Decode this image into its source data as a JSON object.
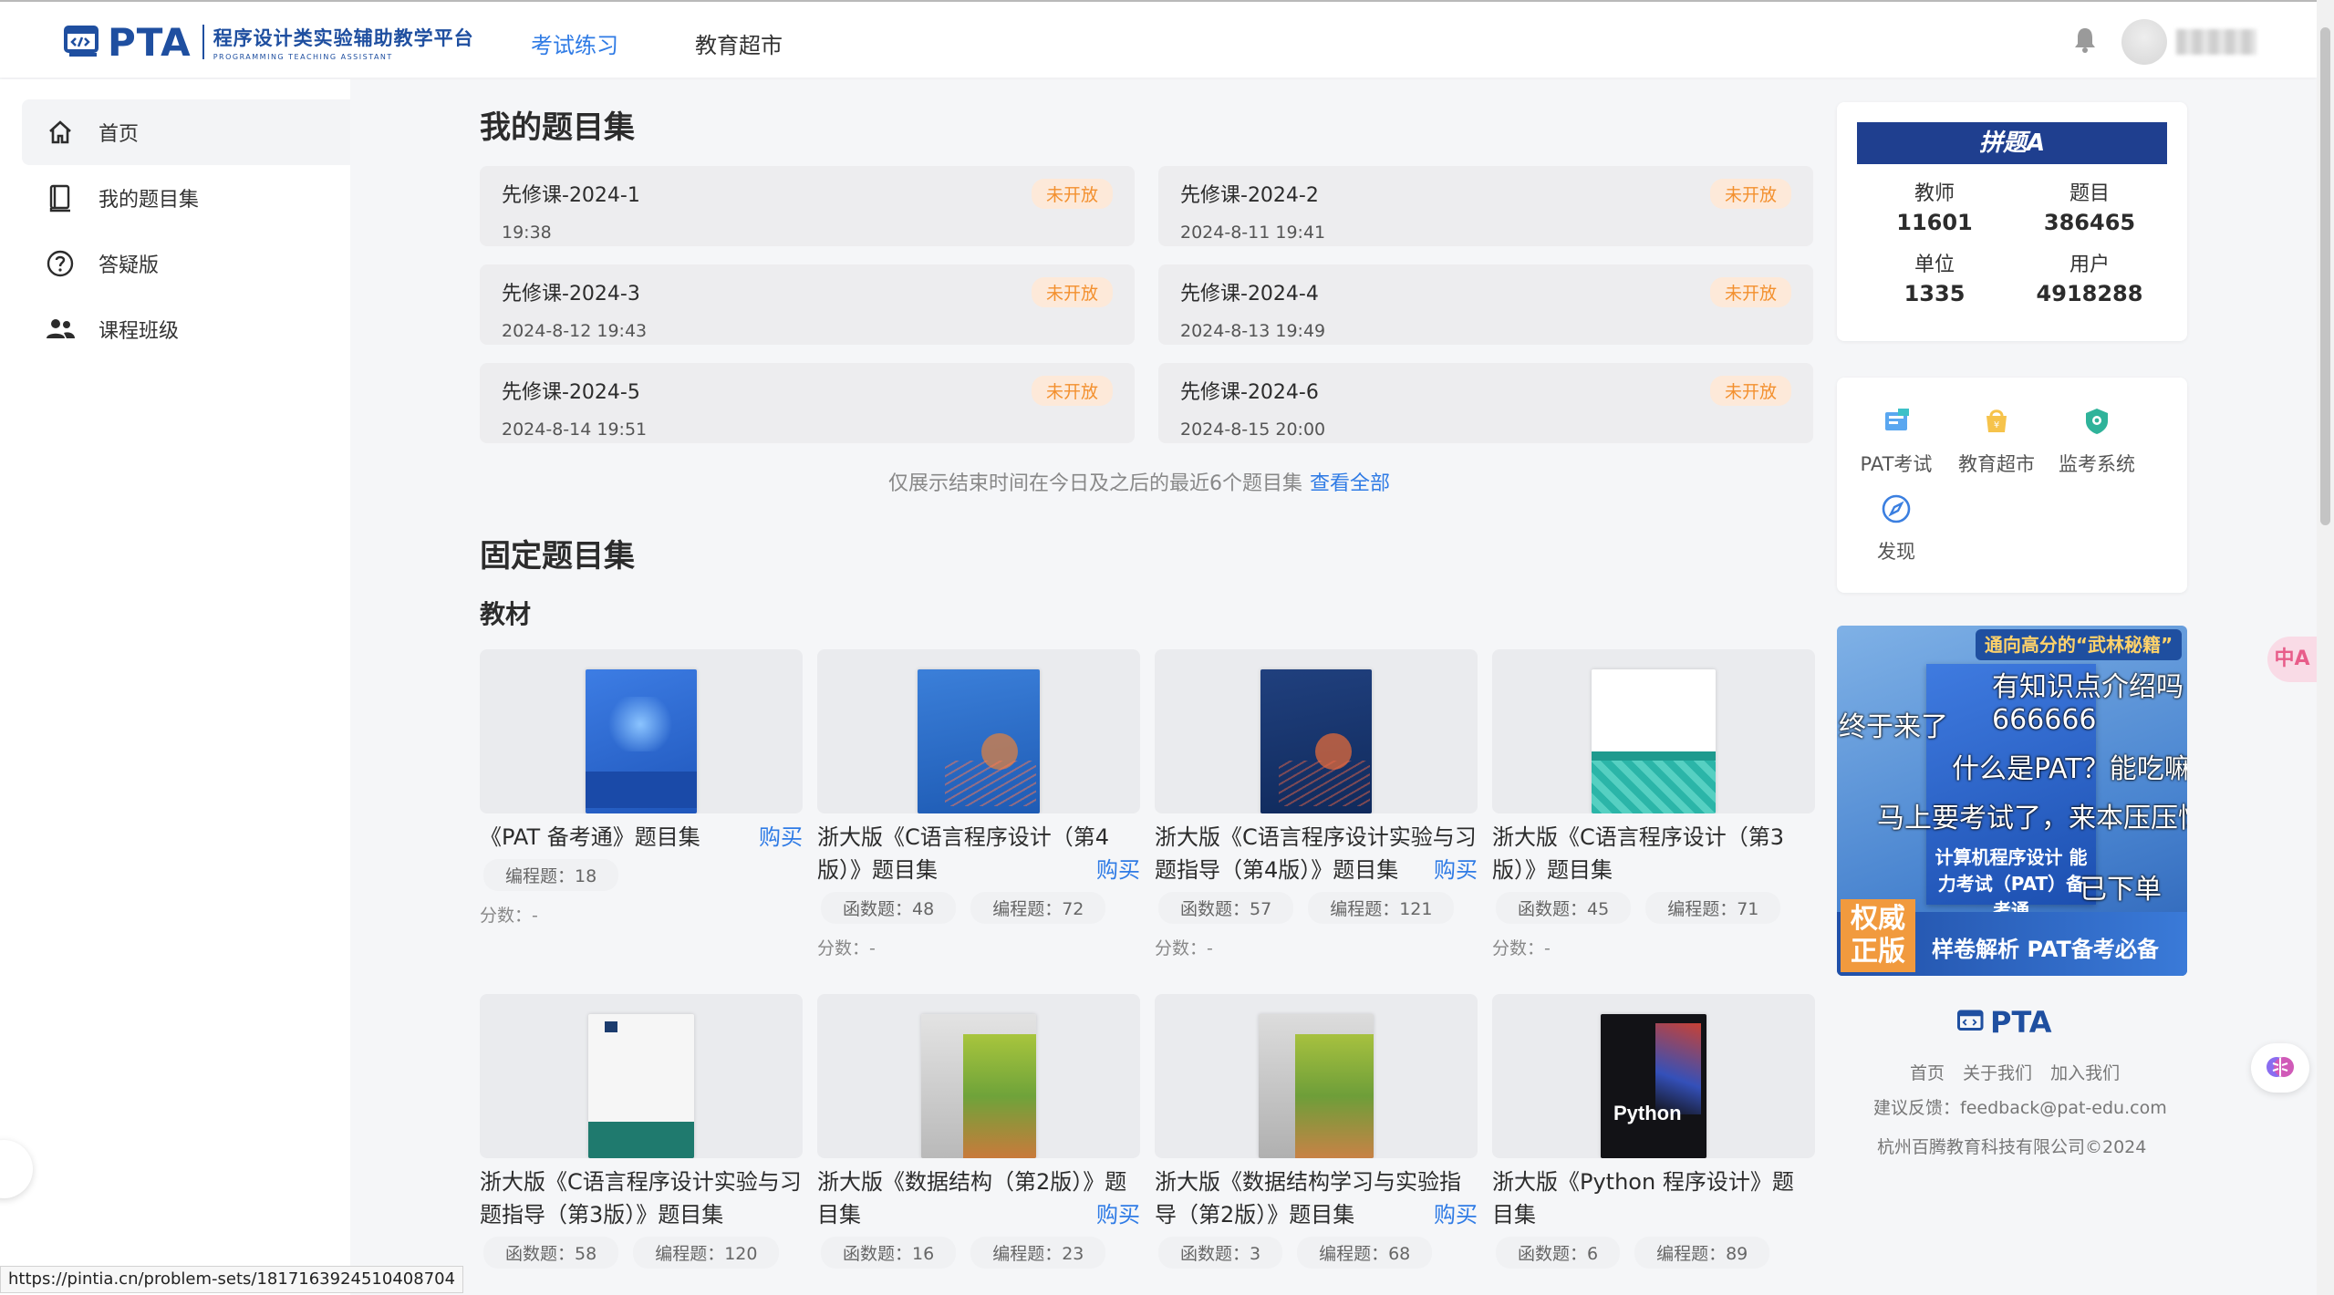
{
  "header": {
    "logo_pta": "PTA",
    "logo_cn": "程序设计类实验辅助教学平台",
    "logo_en": "PROGRAMMING TEACHING ASSISTANT",
    "nav": [
      "考试练习",
      "教育超市"
    ]
  },
  "sidebar": {
    "items": [
      {
        "label": "首页",
        "icon": "home-icon"
      },
      {
        "label": "我的题目集",
        "icon": "book-icon"
      },
      {
        "label": "答疑版",
        "icon": "question-icon"
      },
      {
        "label": "课程班级",
        "icon": "people-icon"
      }
    ]
  },
  "my_sets": {
    "title": "我的题目集",
    "items": [
      {
        "name": "先修课-2024-1",
        "time": "19:38",
        "status": "未开放"
      },
      {
        "name": "先修课-2024-2",
        "time": "2024-8-11 19:41",
        "status": "未开放"
      },
      {
        "name": "先修课-2024-3",
        "time": "2024-8-12 19:43",
        "status": "未开放"
      },
      {
        "name": "先修课-2024-4",
        "time": "2024-8-13 19:49",
        "status": "未开放"
      },
      {
        "name": "先修课-2024-5",
        "time": "2024-8-14 19:51",
        "status": "未开放"
      },
      {
        "name": "先修课-2024-6",
        "time": "2024-8-15 20:00",
        "status": "未开放"
      }
    ],
    "hint": "仅展示结束时间在今日及之后的最近6个题目集",
    "view_all": "查看全部"
  },
  "fixed_sets": {
    "title": "固定题目集",
    "subtitle": "教材",
    "buy_label": "购买",
    "books": [
      {
        "title": "《PAT 备考通》题目集",
        "buy": true,
        "tags": [
          "编程题：18"
        ],
        "score": "分数：-",
        "cover": "pat"
      },
      {
        "title": "浙大版《C语言程序设计（第4版）》题目集",
        "buy": true,
        "tags": [
          "函数题：48",
          "编程题：72"
        ],
        "score": "分数：-",
        "cover": "c4"
      },
      {
        "title": "浙大版《C语言程序设计实验与习题指导（第4版）》题目集",
        "buy": true,
        "tags": [
          "函数题：57",
          "编程题：121"
        ],
        "score": "分数：-",
        "cover": "c4lab"
      },
      {
        "title": "浙大版《C语言程序设计（第3版）》题目集",
        "buy": false,
        "tags": [
          "函数题：45",
          "编程题：71"
        ],
        "score": "分数：-",
        "cover": "c3"
      },
      {
        "title": "浙大版《C语言程序设计实验与习题指导（第3版）》题目集",
        "buy": false,
        "tags": [
          "函数题：58",
          "编程题：120"
        ],
        "score": "",
        "cover": "c3lab"
      },
      {
        "title": "浙大版《数据结构（第2版）》题目集",
        "buy": true,
        "tags": [
          "函数题：16",
          "编程题：23"
        ],
        "score": "",
        "cover": "ds"
      },
      {
        "title": "浙大版《数据结构学习与实验指导（第2版）》题目集",
        "buy": true,
        "tags": [
          "函数题：3",
          "编程题：68"
        ],
        "score": "",
        "cover": "dslab"
      },
      {
        "title": "浙大版《Python 程序设计》题目集",
        "buy": false,
        "tags": [
          "函数题：6",
          "编程题：89"
        ],
        "score": "",
        "cover": "py"
      }
    ]
  },
  "stats": {
    "banner": "拼题A",
    "items": [
      {
        "label": "教师",
        "value": "11601"
      },
      {
        "label": "题目",
        "value": "386465"
      },
      {
        "label": "单位",
        "value": "1335"
      },
      {
        "label": "用户",
        "value": "4918288"
      }
    ]
  },
  "quick_links": [
    {
      "label": "PAT考试",
      "icon": "pat-exam-icon"
    },
    {
      "label": "教育超市",
      "icon": "shop-icon"
    },
    {
      "label": "监考系统",
      "icon": "proctor-icon"
    },
    {
      "label": "发现",
      "icon": "compass-icon"
    }
  ],
  "ad": {
    "top": "通向高分的“武林秘籍”",
    "book_title": "计算机程序设计 能力考试（PAT）备考通",
    "seal": "权威正版",
    "slogan": "样卷解析  PAT备考必备",
    "danmu": [
      "有知识点介绍吗",
      "终于来了",
      "666666",
      "什么是PAT？能吃嘛",
      "马上要考试了，来本压压惊",
      "已下单"
    ]
  },
  "footer": {
    "logo": "PTA",
    "links": "首页 关于我们 加入我们",
    "feedback": "建议反馈：feedback@pat-edu.com",
    "copyright": "杭州百腾教育科技有限公司©2024"
  },
  "status_url": "https://pintia.cn/problem-sets/1817163924510408704",
  "float_pink": "中A",
  "colors": {
    "brand": "#1f4fa0",
    "accent": "#2f7be5",
    "badge": "#f3902e"
  }
}
